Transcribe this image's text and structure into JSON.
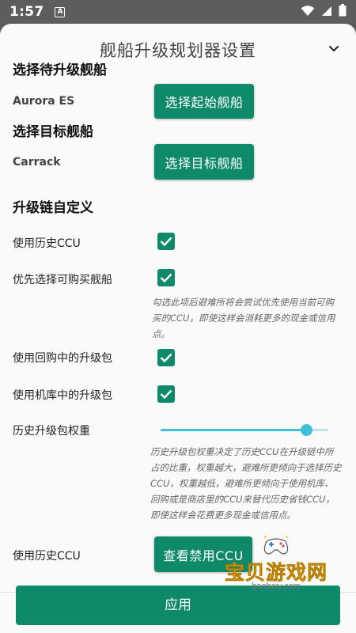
{
  "status_bar": {
    "time": "1:57",
    "notification_icon": "a-notification-icon",
    "icons": [
      "wifi-icon",
      "signal-icon",
      "battery-icon"
    ]
  },
  "dialog": {
    "title": "舰船升级规划器设置",
    "collapse_icon": "chevron-down-icon"
  },
  "start_ship": {
    "heading": "选择待升级舰船",
    "value": "Aurora ES",
    "button_label": "选择起始舰船"
  },
  "target_ship": {
    "heading": "选择目标舰船",
    "value": "Carrack",
    "button_label": "选择目标舰船"
  },
  "chain": {
    "heading": "升级链自定义",
    "options": [
      {
        "label": "使用历史CCU",
        "checked": true
      },
      {
        "label": "优先选择可购买舰船",
        "checked": true,
        "note": "勾选此项后避难所将会尝试优先使用当前可购买的CCU，即使这样会消耗更多的现金或信用点。"
      },
      {
        "label": "使用回购中的升级包",
        "checked": true
      },
      {
        "label": "使用机库中的升级包",
        "checked": true
      }
    ],
    "weight": {
      "label": "历史升级包权重",
      "value": 0.87,
      "note": "历史升级包权重决定了历史CCU在升级链中所占的比重，权重越大，避难所更倾向于选择历史CCU，权重越低，避难所更倾向于使用机库、回购或是商店里的CCU来替代历史省钱CCU，即使这样会花费更多现金或信用点。"
    },
    "banned": {
      "label": "使用历史CCU",
      "button_label": "查看禁用CCU"
    }
  },
  "apply_label": "应用",
  "watermark": {
    "title": "宝贝游戏网",
    "url": "baobeiy.com",
    "icon": "gamepad-icon"
  },
  "colors": {
    "accent": "#0e8a6a",
    "slider": "#3ec1d8",
    "watermark": "#f4c01b"
  }
}
